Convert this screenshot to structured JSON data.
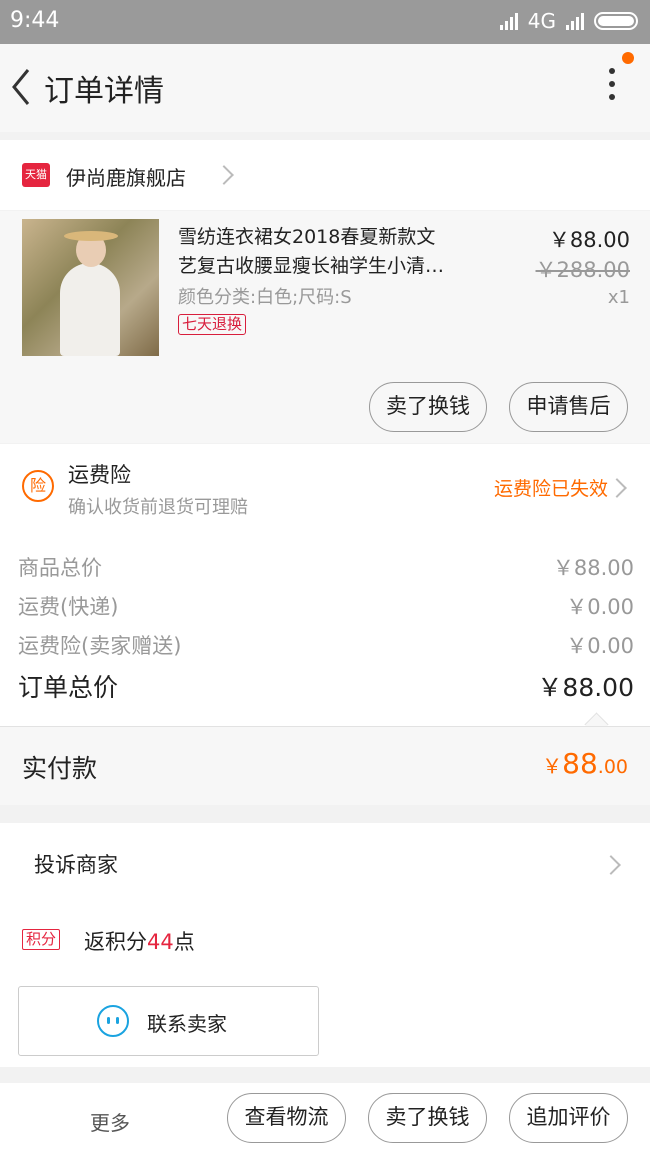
{
  "status": {
    "time": "9:44",
    "network": "4G"
  },
  "header": {
    "title": "订单详情"
  },
  "shop": {
    "badge": "天猫",
    "name": "伊尚鹿旗舰店"
  },
  "item": {
    "title_line1": "雪纺连衣裙女2018春夏新款文",
    "title_line2": "艺复古收腰显瘦长袖学生小清…",
    "spec": "颜色分类:白色;尺码:S",
    "tag": "七天退换",
    "price": "￥88.00",
    "original_price": "￥288.00",
    "quantity": "x1",
    "actions": [
      "卖了换钱",
      "申请售后"
    ]
  },
  "insurance": {
    "icon": "险",
    "title": "运费险",
    "subtitle": "确认收货前退货可理赔",
    "status": "运费险已失效"
  },
  "price_rows": [
    {
      "label": "商品总价",
      "value": "￥88.00"
    },
    {
      "label": "运费(快递)",
      "value": "￥0.00"
    },
    {
      "label": "运费险(卖家赠送)",
      "value": "￥0.00"
    }
  ],
  "total": {
    "label": "订单总价",
    "value": "￥88.00"
  },
  "paid": {
    "label": "实付款",
    "currency": "￥",
    "int": "88",
    "dec": ".00"
  },
  "complain": "投诉商家",
  "points": {
    "badge": "积分",
    "prefix": "返积分",
    "num": "44",
    "suffix": "点"
  },
  "contact_label": "联系卖家",
  "bottom": {
    "more": "更多",
    "buttons": [
      "查看物流",
      "卖了换钱",
      "追加评价"
    ]
  },
  "colors": {
    "accent": "#ff6a00",
    "tmall_red": "#e5253f",
    "wangwang_blue": "#1aa3e0"
  }
}
